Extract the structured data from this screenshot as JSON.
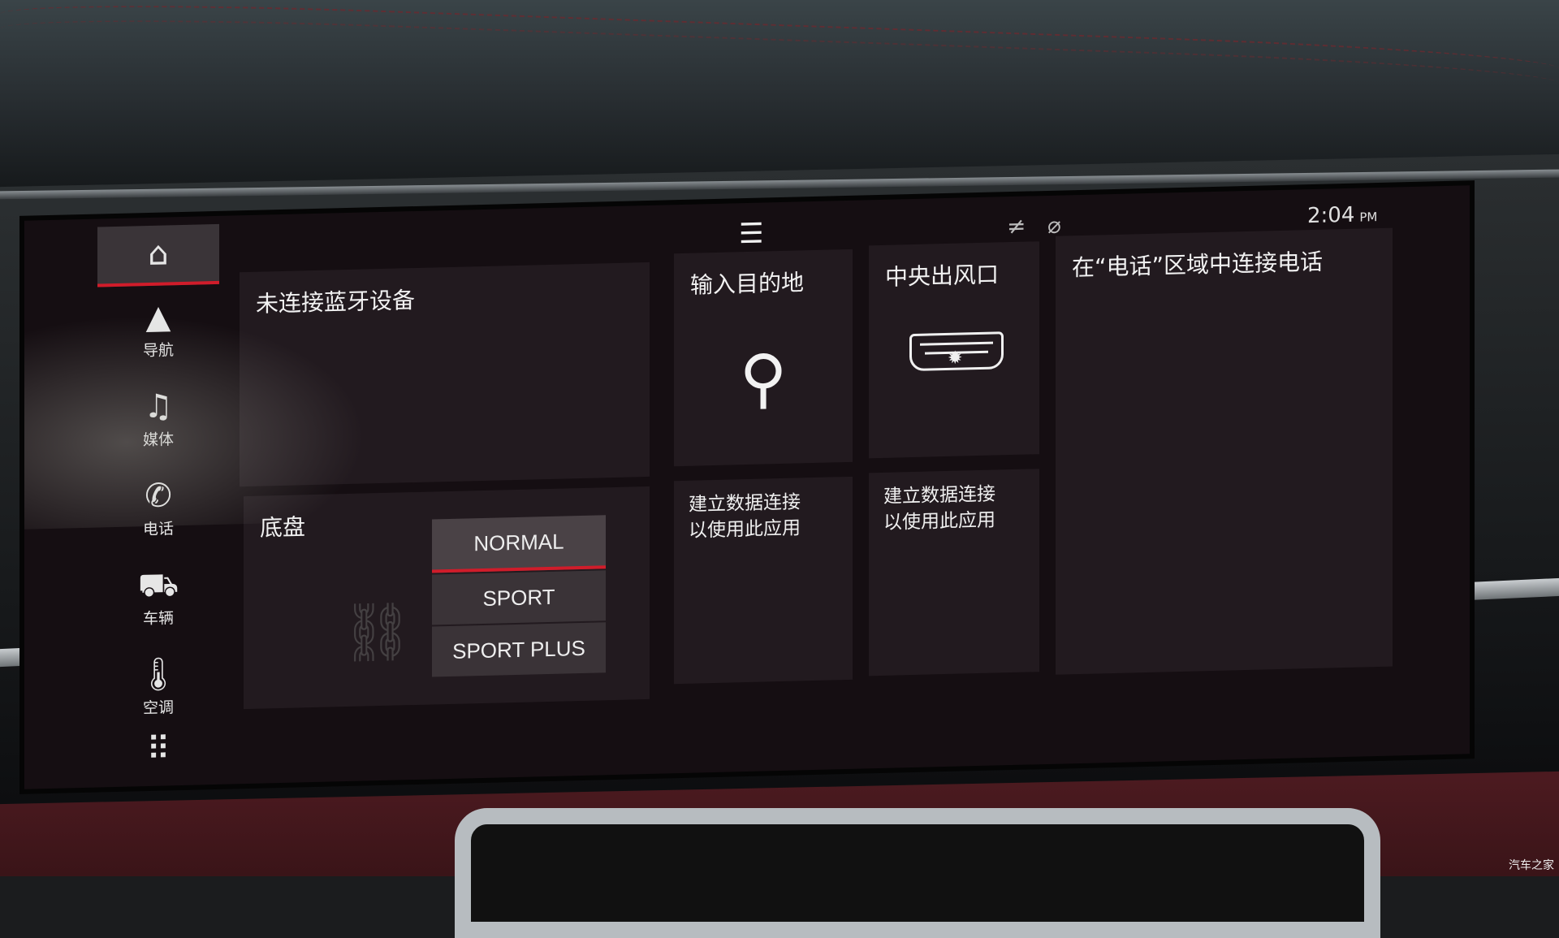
{
  "sidebar": {
    "items": [
      {
        "label": "",
        "icon": "home-icon",
        "glyph": "⌂"
      },
      {
        "label": "导航",
        "icon": "navigation-arrow-icon",
        "glyph": "▲"
      },
      {
        "label": "媒体",
        "icon": "music-note-icon",
        "glyph": "♫"
      },
      {
        "label": "电话",
        "icon": "phone-icon",
        "glyph": "✆"
      },
      {
        "label": "车辆",
        "icon": "car-icon",
        "glyph": "🚗"
      },
      {
        "label": "空调",
        "icon": "thermometer-icon",
        "glyph": "🌡"
      },
      {
        "label": "",
        "icon": "apps-grid-icon",
        "glyph": "⠿"
      }
    ]
  },
  "statusbar": {
    "menu_glyph": "☰",
    "time": "2:04",
    "ampm": "PM",
    "icons": [
      "no-data-icon",
      "no-signal-icon"
    ]
  },
  "tiles": {
    "bluetooth": {
      "title": "未连接蓝牙设备"
    },
    "destination": {
      "title": "输入目的地",
      "icon": "search-icon",
      "glyph": "⚲"
    },
    "vents": {
      "title": "中央出风口",
      "icon": "air-vent-icon"
    },
    "phone": {
      "title": "在“电话”区域中连接电话"
    },
    "chassis": {
      "title": "底盘",
      "options": [
        "NORMAL",
        "SPORT",
        "SPORT PLUS"
      ],
      "selected": "NORMAL"
    },
    "app1": {
      "line1": "建立数据连接",
      "line2": "以使用此应用"
    },
    "app2": {
      "line1": "建立数据连接",
      "line2": "以使用此应用"
    }
  },
  "watermark": "汽车之家",
  "colors": {
    "accent": "#d01c2a",
    "tile": "#221a1f",
    "screen": "#150e12"
  }
}
